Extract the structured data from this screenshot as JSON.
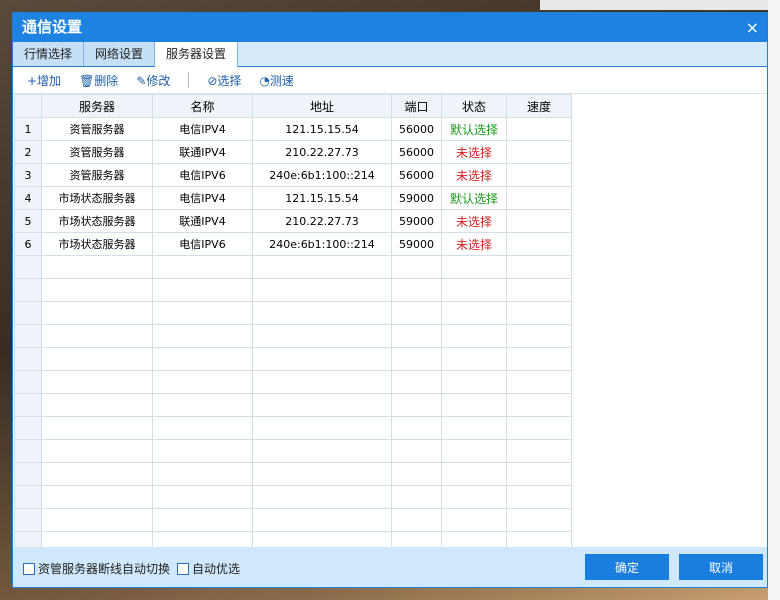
{
  "dialog": {
    "title": "通信设置",
    "close": "×"
  },
  "tabs": [
    "行情选择",
    "网络设置",
    "服务器设置"
  ],
  "toolbar": {
    "add": "+增加",
    "delete": "🗑删除",
    "edit": "✎修改",
    "select": "⊘选择",
    "speed": "◔测速"
  },
  "table": {
    "headers": [
      "",
      "服务器",
      "名称",
      "地址",
      "端口",
      "状态",
      "速度"
    ],
    "rows": [
      {
        "n": "1",
        "server": "资管服务器",
        "name": "电信IPV4",
        "addr": "121.15.15.54",
        "port": "56000",
        "status": "默认选择",
        "s": "green"
      },
      {
        "n": "2",
        "server": "资管服务器",
        "name": "联通IPV4",
        "addr": "210.22.27.73",
        "port": "56000",
        "status": "未选择",
        "s": "red"
      },
      {
        "n": "3",
        "server": "资管服务器",
        "name": "电信IPV6",
        "addr": "240e:6b1:100::214",
        "port": "56000",
        "status": "未选择",
        "s": "red"
      },
      {
        "n": "4",
        "server": "市场状态服务器",
        "name": "电信IPV4",
        "addr": "121.15.15.54",
        "port": "59000",
        "status": "默认选择",
        "s": "green"
      },
      {
        "n": "5",
        "server": "市场状态服务器",
        "name": "联通IPV4",
        "addr": "210.22.27.73",
        "port": "59000",
        "status": "未选择",
        "s": "red"
      },
      {
        "n": "6",
        "server": "市场状态服务器",
        "name": "电信IPV6",
        "addr": "240e:6b1:100::214",
        "port": "59000",
        "status": "未选择",
        "s": "red"
      }
    ]
  },
  "footer": {
    "auto_switch": "资管服务器断线自动切换",
    "auto_best": "自动优选",
    "ok": "确定",
    "cancel": "取消"
  }
}
